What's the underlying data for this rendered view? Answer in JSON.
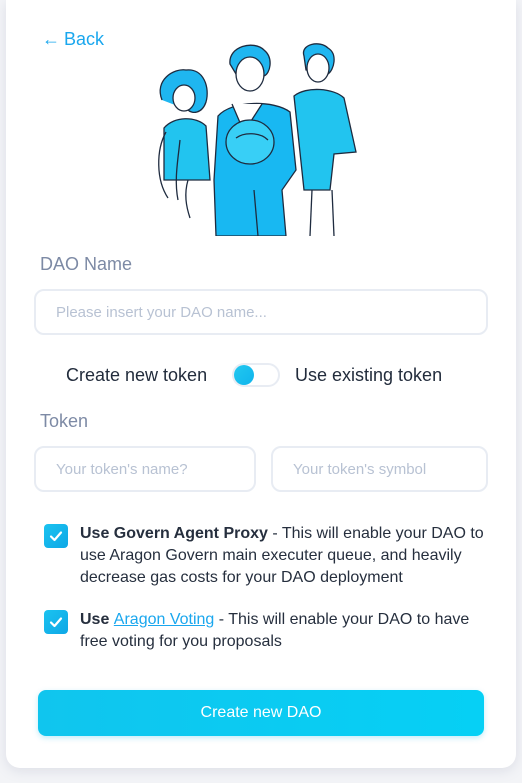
{
  "nav": {
    "back_label": "Back"
  },
  "form": {
    "dao_name": {
      "label": "DAO Name",
      "value": "",
      "placeholder": "Please insert your DAO name..."
    },
    "token_mode": {
      "left_label": "Create new token",
      "right_label": "Use existing token",
      "selected": "Create new token"
    },
    "token": {
      "label": "Token",
      "name_placeholder": "Your token's name?",
      "symbol_placeholder": "Your token's symbol"
    },
    "options": [
      {
        "checked": true,
        "title": "Use Govern Agent Proxy",
        "description": " - This will enable your DAO to use Aragon Govern main executer queue, and heavily decrease gas costs for your DAO deployment"
      },
      {
        "checked": true,
        "prefix": "Use ",
        "link": "Aragon Voting",
        "description": " - This will enable your DAO to have free voting for you proposals"
      }
    ],
    "submit_label": "Create new DAO"
  },
  "colors": {
    "accent": "#1aa7ee",
    "button": "#10c5ee",
    "label": "#7d8aa5",
    "border": "#e8ecf3"
  },
  "icons": {
    "back": "left-arrow-icon",
    "check": "checkmark-icon"
  }
}
